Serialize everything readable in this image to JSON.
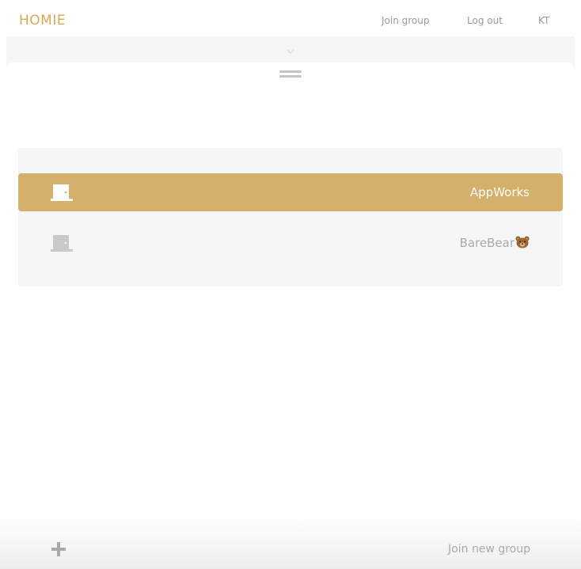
{
  "header": {
    "logo": "HOMIE",
    "nav": {
      "join_group": "Join group",
      "log_out": "Log out",
      "user_initials": "KT"
    }
  },
  "sheet": {
    "collapse_icon": "chevron-down-icon",
    "drag_handle_icon": "drag-handle-icon"
  },
  "groups": {
    "items": [
      {
        "label": "AppWorks",
        "icon": "door-icon",
        "selected": true
      },
      {
        "label": "BareBear",
        "icon": "door-icon",
        "emoji": "bear-face-icon",
        "selected": false
      }
    ]
  },
  "footer": {
    "icon": "plus-icon",
    "join_label": "Join new group"
  },
  "colors": {
    "brand": "#d4a94f",
    "selected_bg": "#d4b06b",
    "panel_bg": "#f6f6f6",
    "muted_text": "#aaaaaa"
  }
}
